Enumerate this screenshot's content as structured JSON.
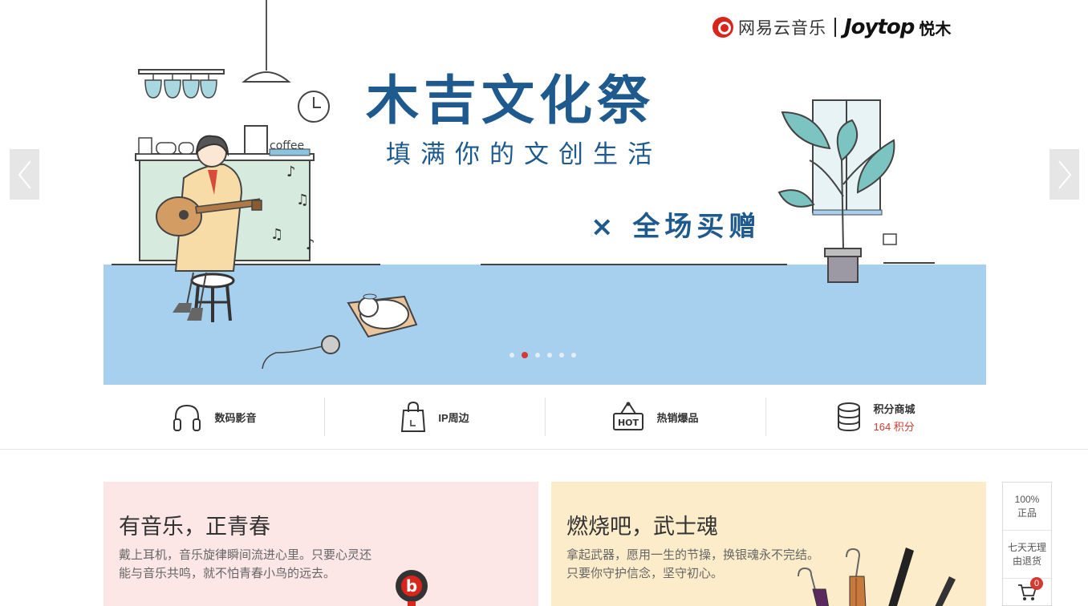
{
  "header": {
    "brand_netease": "网易云音乐",
    "brand_joytop": "Joytop",
    "brand_yuemu": "悦木"
  },
  "banner": {
    "headline": "木吉文化祭",
    "subhead": "填满你的文创生活",
    "promo": "× 全场买赠",
    "cafe_sign": "coffee",
    "slides_count": 6,
    "active_slide": 2,
    "colors": {
      "floor": "#a7d0ee",
      "headline": "#1f5a8e",
      "counter": "#d6ebdd"
    }
  },
  "categories": [
    {
      "label": "数码影音",
      "icon": "headphones-icon"
    },
    {
      "label": "IP周边",
      "icon": "shopping-bag-icon"
    },
    {
      "label": "热销爆品",
      "icon": "hot-tag-icon",
      "icon_text": "HOT"
    },
    {
      "label": "积分商城",
      "sub": "164 积分",
      "icon": "database-icon"
    }
  ],
  "cards": [
    {
      "title": "有音乐，正青春",
      "desc": "戴上耳机，音乐旋律瞬间流进心里。只要心灵还能与音乐共鸣，就不怕青春小鸟的远去。",
      "bg": "#fde6e6"
    },
    {
      "title": "燃烧吧，武士魂",
      "desc": "拿起武器，愿用一生的节操，换银魂永不完结。只要你守护信念，坚守初心。",
      "bg": "#fdecc9"
    }
  ],
  "sidebar": {
    "guarantee_line1": "100%",
    "guarantee_line2": "正品",
    "returns_line1": "七天无理",
    "returns_line2": "由退货",
    "cart_count": "0"
  },
  "accent_color": "#d33a31"
}
